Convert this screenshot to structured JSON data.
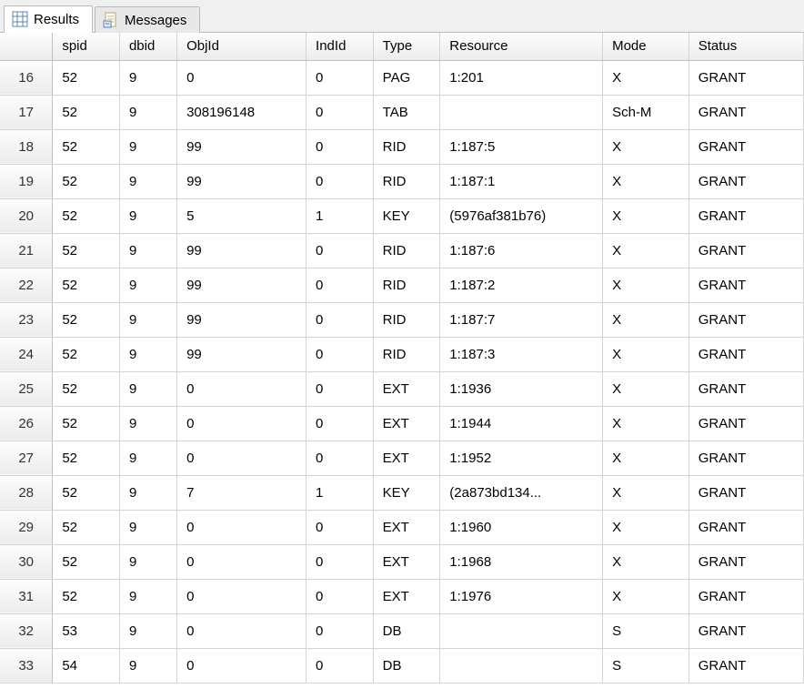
{
  "tabs": {
    "results_label": "Results",
    "messages_label": "Messages"
  },
  "table": {
    "headers": {
      "spid": "spid",
      "dbid": "dbid",
      "objid": "ObjId",
      "indid": "IndId",
      "type": "Type",
      "resource": "Resource",
      "mode": "Mode",
      "status": "Status"
    },
    "rows": [
      {
        "n": "16",
        "spid": "52",
        "dbid": "9",
        "objid": "0",
        "indid": "0",
        "type": "PAG",
        "resource": "1:201",
        "mode": "X",
        "status": "GRANT"
      },
      {
        "n": "17",
        "spid": "52",
        "dbid": "9",
        "objid": "308196148",
        "indid": "0",
        "type": "TAB",
        "resource": "",
        "mode": "Sch-M",
        "status": "GRANT"
      },
      {
        "n": "18",
        "spid": "52",
        "dbid": "9",
        "objid": "99",
        "indid": "0",
        "type": "RID",
        "resource": "1:187:5",
        "mode": "X",
        "status": "GRANT"
      },
      {
        "n": "19",
        "spid": "52",
        "dbid": "9",
        "objid": "99",
        "indid": "0",
        "type": "RID",
        "resource": "1:187:1",
        "mode": "X",
        "status": "GRANT"
      },
      {
        "n": "20",
        "spid": "52",
        "dbid": "9",
        "objid": "5",
        "indid": "1",
        "type": "KEY",
        "resource": "(5976af381b76)",
        "mode": "X",
        "status": "GRANT"
      },
      {
        "n": "21",
        "spid": "52",
        "dbid": "9",
        "objid": "99",
        "indid": "0",
        "type": "RID",
        "resource": "1:187:6",
        "mode": "X",
        "status": "GRANT"
      },
      {
        "n": "22",
        "spid": "52",
        "dbid": "9",
        "objid": "99",
        "indid": "0",
        "type": "RID",
        "resource": "1:187:2",
        "mode": "X",
        "status": "GRANT"
      },
      {
        "n": "23",
        "spid": "52",
        "dbid": "9",
        "objid": "99",
        "indid": "0",
        "type": "RID",
        "resource": "1:187:7",
        "mode": "X",
        "status": "GRANT"
      },
      {
        "n": "24",
        "spid": "52",
        "dbid": "9",
        "objid": "99",
        "indid": "0",
        "type": "RID",
        "resource": "1:187:3",
        "mode": "X",
        "status": "GRANT"
      },
      {
        "n": "25",
        "spid": "52",
        "dbid": "9",
        "objid": "0",
        "indid": "0",
        "type": "EXT",
        "resource": "1:1936",
        "mode": "X",
        "status": "GRANT"
      },
      {
        "n": "26",
        "spid": "52",
        "dbid": "9",
        "objid": "0",
        "indid": "0",
        "type": "EXT",
        "resource": "1:1944",
        "mode": "X",
        "status": "GRANT"
      },
      {
        "n": "27",
        "spid": "52",
        "dbid": "9",
        "objid": "0",
        "indid": "0",
        "type": "EXT",
        "resource": "1:1952",
        "mode": "X",
        "status": "GRANT"
      },
      {
        "n": "28",
        "spid": "52",
        "dbid": "9",
        "objid": "7",
        "indid": "1",
        "type": "KEY",
        "resource": "(2a873bd134...",
        "mode": "X",
        "status": "GRANT"
      },
      {
        "n": "29",
        "spid": "52",
        "dbid": "9",
        "objid": "0",
        "indid": "0",
        "type": "EXT",
        "resource": "1:1960",
        "mode": "X",
        "status": "GRANT"
      },
      {
        "n": "30",
        "spid": "52",
        "dbid": "9",
        "objid": "0",
        "indid": "0",
        "type": "EXT",
        "resource": "1:1968",
        "mode": "X",
        "status": "GRANT"
      },
      {
        "n": "31",
        "spid": "52",
        "dbid": "9",
        "objid": "0",
        "indid": "0",
        "type": "EXT",
        "resource": "1:1976",
        "mode": "X",
        "status": "GRANT"
      },
      {
        "n": "32",
        "spid": "53",
        "dbid": "9",
        "objid": "0",
        "indid": "0",
        "type": "DB",
        "resource": "",
        "mode": "S",
        "status": "GRANT"
      },
      {
        "n": "33",
        "spid": "54",
        "dbid": "9",
        "objid": "0",
        "indid": "0",
        "type": "DB",
        "resource": "",
        "mode": "S",
        "status": "GRANT"
      }
    ]
  }
}
